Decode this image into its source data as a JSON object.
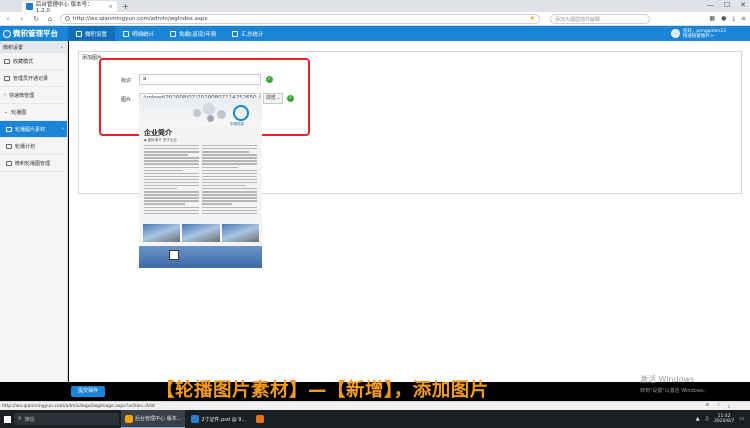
{
  "browser": {
    "tab_title": "后台管理中心 版本号：1.2.0",
    "url": "http://wx.qianmingyun.com/admin/wgIndex.aspx",
    "search_placeholder": "添加大疆圆插件解释"
  },
  "app": {
    "logo_text": "微积管理平台",
    "nav": [
      {
        "label": "微积设置",
        "active": true
      },
      {
        "label": "明细统计",
        "active": false
      },
      {
        "label": "免缴(返现)年费",
        "active": false
      },
      {
        "label": "汇总统计",
        "active": false
      }
    ],
    "user": {
      "line1": "您好，pengqimin23",
      "line2": "快速链接图片>"
    }
  },
  "sidebar": {
    "header": "微积设置",
    "items": [
      {
        "label": "收藏模式",
        "sub": false,
        "active": false
      },
      {
        "label": "管理员开通记录",
        "sub": false,
        "active": false
      },
      {
        "label": "快速微管理",
        "sub": false,
        "active": false
      },
      {
        "label": "轮播图",
        "sub": false,
        "active": false
      },
      {
        "label": "轮播图片素材",
        "sub": true,
        "active": true
      },
      {
        "label": "轮播计划",
        "sub": true,
        "active": false
      },
      {
        "label": "微积轮播图管理",
        "sub": true,
        "active": false
      }
    ]
  },
  "form": {
    "section_title": "添加图片",
    "title_label": "标识",
    "title_value": "a",
    "image_label": "图片",
    "image_value": "/upload/202008/07/20200807114252650.jpg",
    "browse_label": "浏览...",
    "submit_label": "提交保存"
  },
  "preview": {
    "heading": "企业简介",
    "subheading": "◆ 团队简介 关于企业",
    "logo_caption": "中国伟发"
  },
  "overlay": {
    "caption": "【轮播图片素材】—【新增】，添加图片",
    "watermark_line1": "激活 Windows",
    "watermark_line2": "转到\"设置\"以激活 Windows。"
  },
  "status": {
    "url": "http://wx.qianmingyun.com/admin/wgui/wgimage.aspx?action=Add"
  },
  "taskbar": {
    "search_text": "微信",
    "apps": [
      {
        "label": "后台管理中心 版本...",
        "active": true,
        "color": "#f2a400"
      },
      {
        "label": "2寸证件.psd @ 9...",
        "active": false,
        "color": "#2b7bd1"
      },
      {
        "label": "",
        "active": false,
        "color": "#e5731c"
      }
    ],
    "time": "11:42",
    "date": "2020/8/7"
  }
}
